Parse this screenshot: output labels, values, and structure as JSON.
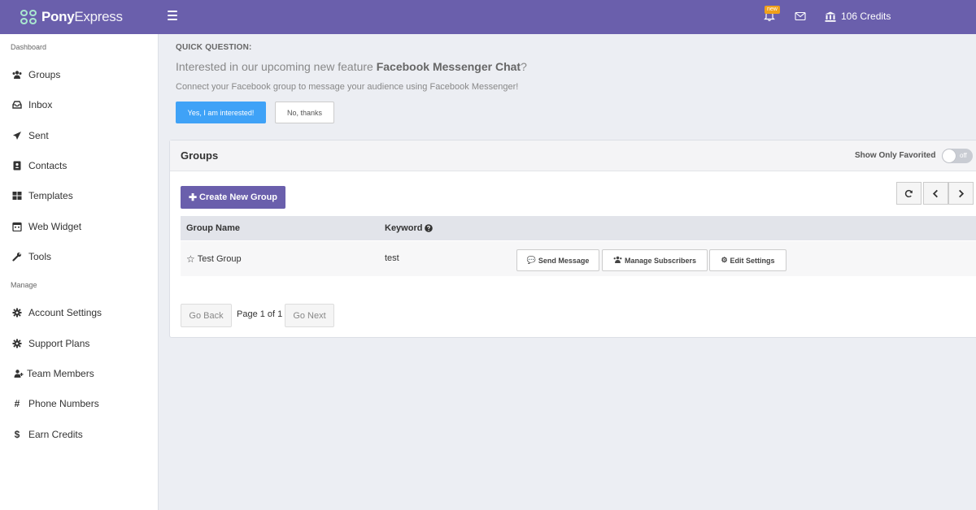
{
  "brand": {
    "name_bold": "Pony",
    "name_light": "Express"
  },
  "topbar": {
    "menu_icon": "hamburger-icon",
    "notification_badge": "new",
    "credits_label": "106 Credits",
    "accent": "#6a5fac"
  },
  "sidebar": {
    "section_dashboard": "Dashboard",
    "section_manage": "Manage",
    "items": [
      {
        "label": "Groups",
        "icon": "users-icon"
      },
      {
        "label": "Inbox",
        "icon": "inbox-icon"
      },
      {
        "label": "Sent",
        "icon": "paper-plane-icon"
      },
      {
        "label": "Contacts",
        "icon": "address-book-icon"
      },
      {
        "label": "Templates",
        "icon": "grid-icon"
      },
      {
        "label": "Web Widget",
        "icon": "calendar-icon"
      },
      {
        "label": "Tools",
        "icon": "wrench-icon"
      },
      {
        "label": "Account Settings",
        "icon": "gear-icon"
      },
      {
        "label": "Support Plans",
        "icon": "gear-icon"
      },
      {
        "label": "Team Members",
        "icon": "user-plus-icon"
      },
      {
        "label": "Phone Numbers",
        "icon": "hash-icon"
      },
      {
        "label": "Earn Credits",
        "icon": "dollar-icon"
      }
    ]
  },
  "quick_question": {
    "label": "QUICK QUESTION:",
    "title_prefix": "Interested in our upcoming new feature ",
    "title_feature": "Facebook Messenger Chat",
    "title_suffix": "?",
    "description": "Connect your Facebook group to message your audience using Facebook Messenger!",
    "yes_label": "Yes, I am interested!",
    "no_label": "No, thanks",
    "yes_color": "#3fa2f7"
  },
  "groups_panel": {
    "title": "Groups",
    "favorite_filter_label": "Show Only Favorited",
    "toggle_state": "off",
    "create_label": "Create New Group",
    "columns": [
      "Group Name",
      "Keyword"
    ],
    "rows": [
      {
        "name": "Test Group",
        "keyword": "test",
        "actions": [
          "Send Message",
          "Manage Subscribers",
          "Edit Settings"
        ]
      }
    ],
    "pagination": {
      "prev_label": "Go Back",
      "page_text": "Page 1 of 1",
      "next_label": "Go Next"
    }
  }
}
